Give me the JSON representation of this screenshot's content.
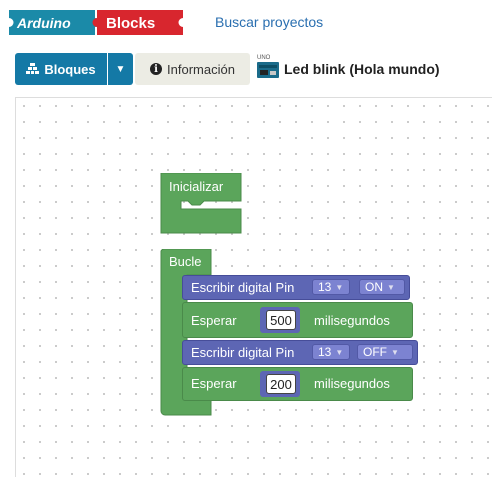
{
  "header": {
    "logo_left": "Arduino",
    "logo_right": "Blocks",
    "nav_link": "Buscar proyectos"
  },
  "toolbar": {
    "bloques_label": "Bloques",
    "info_label": "Información",
    "board_label": "UNO",
    "project_title": "Led blink (Hola mundo)"
  },
  "blocks": {
    "init_label": "Inicializar",
    "loop_label": "Bucle",
    "write1": {
      "label": "Escribir digital Pin",
      "pin": "13",
      "value": "ON"
    },
    "wait1": {
      "label": "Esperar",
      "value": "500",
      "unit": "milisegundos"
    },
    "write2": {
      "label": "Escribir digital Pin",
      "pin": "13",
      "value": "OFF"
    },
    "wait2": {
      "label": "Esperar",
      "value": "200",
      "unit": "milisegundos"
    }
  },
  "colors": {
    "brand_blue": "#1479a6",
    "logo_teal": "#1b8aa8",
    "logo_red": "#d8262e",
    "block_green": "#5ba55b",
    "block_purple": "#5d66b4"
  }
}
